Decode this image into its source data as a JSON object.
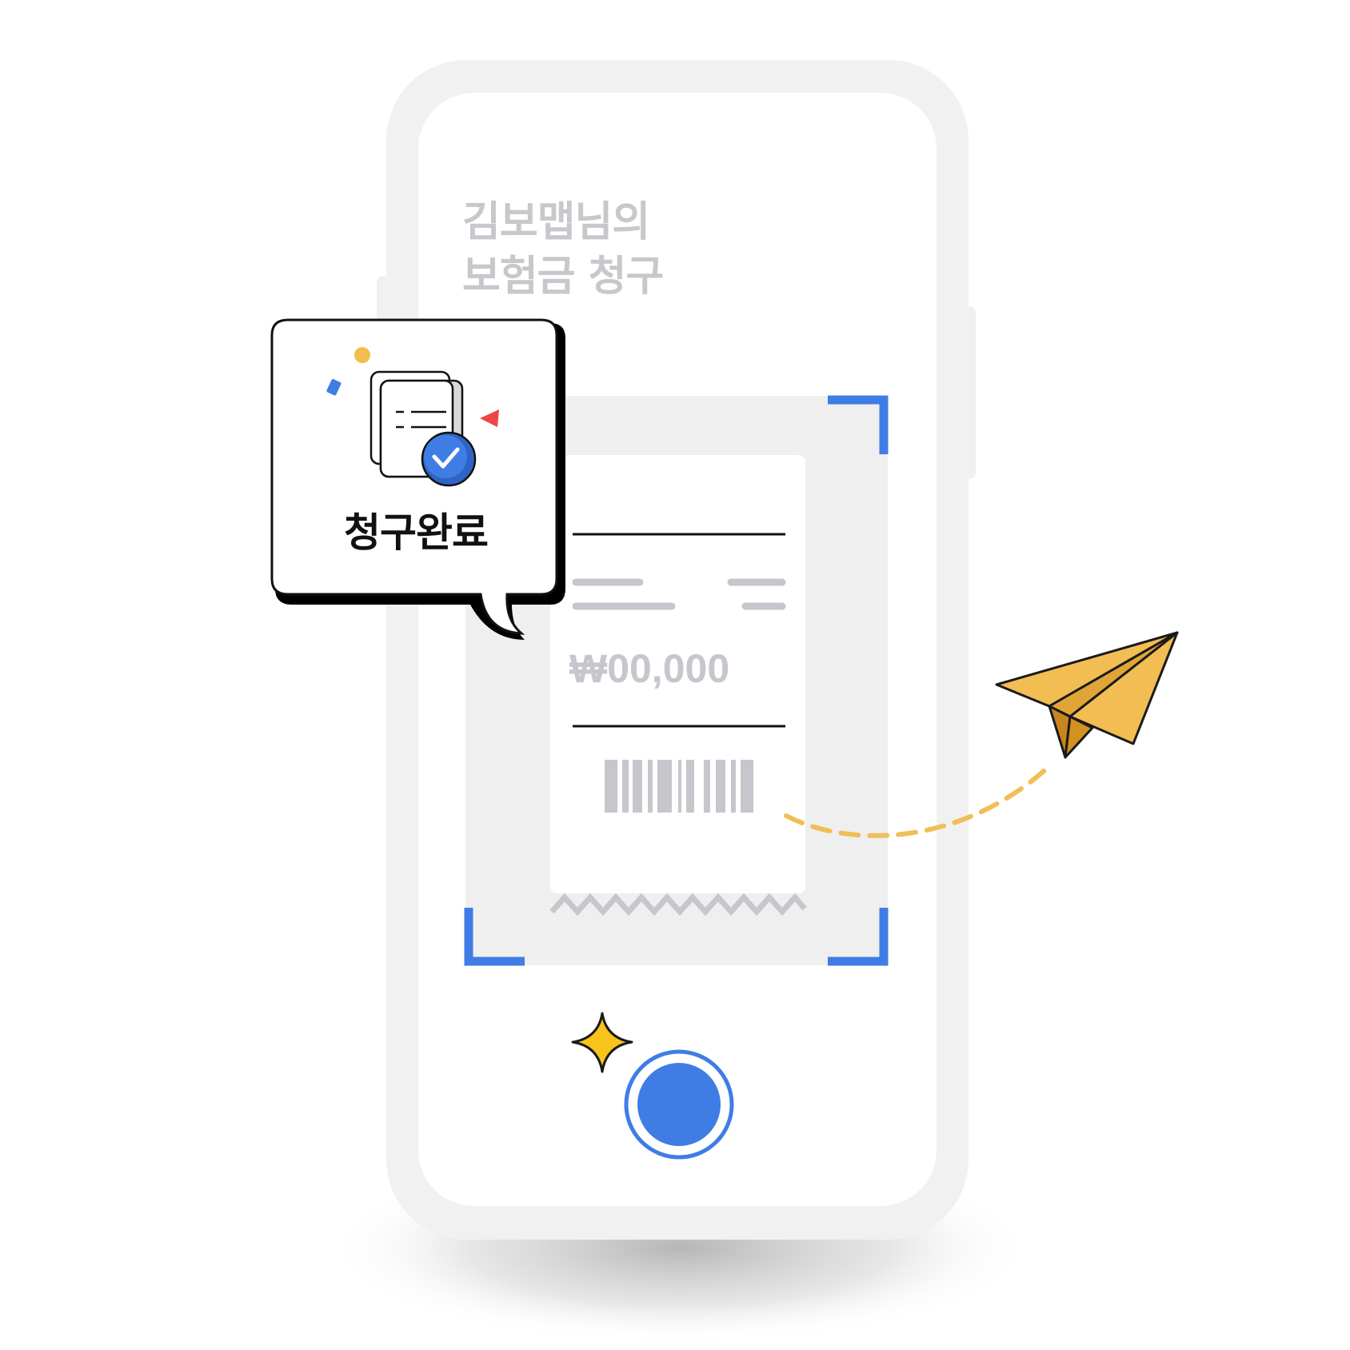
{
  "screen": {
    "title_line1": "김보맵님의",
    "title_line2": "보험금 청구"
  },
  "receipt": {
    "amount": "₩00,000"
  },
  "bubble": {
    "label": "청구완료"
  },
  "colors": {
    "accent_blue": "#3F7DE5",
    "paper_plane": "#F2BD52",
    "sparkle": "#F8C31B",
    "confetti_red": "#EF4545",
    "confetti_yellow": "#F3BD4F",
    "muted_gray": "#C8C8CC"
  },
  "icons": {
    "document": "document-stack-icon",
    "check": "check-badge-icon",
    "plane": "paper-plane-icon",
    "sparkle": "sparkle-icon"
  }
}
